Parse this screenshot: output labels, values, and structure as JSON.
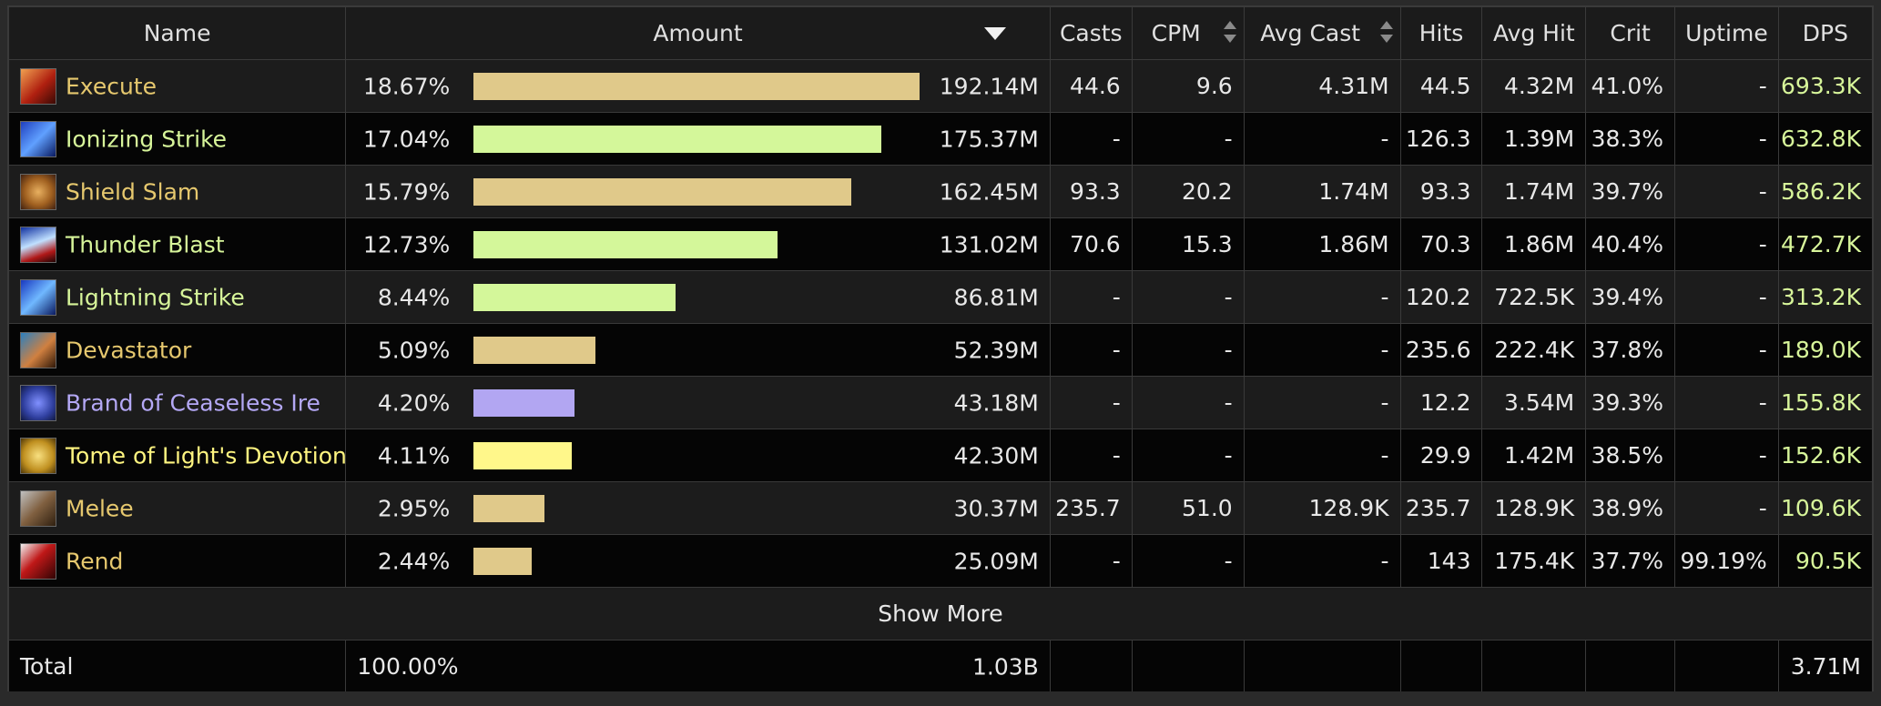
{
  "header": {
    "name": "Name",
    "amount": "Amount",
    "casts": "Casts",
    "cpm": "CPM",
    "avg_cast": "Avg Cast",
    "hits": "Hits",
    "avg_hit": "Avg Hit",
    "crit": "Crit",
    "uptime": "Uptime",
    "dps": "DPS"
  },
  "rows": [
    {
      "name": "Execute",
      "icon": "execute-icon",
      "color": "#e6c86e",
      "pct": "18.67%",
      "bar_fraction": 1.0,
      "bar_color": "#e0c98a",
      "amount": "192.14M",
      "casts": "44.6",
      "cpm": "9.6",
      "avg_cast": "4.31M",
      "hits": "44.5",
      "avg_hit": "4.32M",
      "crit": "41.0%",
      "uptime": "-",
      "dps": "693.3K"
    },
    {
      "name": "Ionizing Strike",
      "icon": "ionizing-strike-icon",
      "color": "#d7f59a",
      "pct": "17.04%",
      "bar_fraction": 0.913,
      "bar_color": "#d4f79a",
      "amount": "175.37M",
      "casts": "-",
      "cpm": "-",
      "avg_cast": "-",
      "hits": "126.3",
      "avg_hit": "1.39M",
      "crit": "38.3%",
      "uptime": "-",
      "dps": "632.8K"
    },
    {
      "name": "Shield Slam",
      "icon": "shield-slam-icon",
      "color": "#e6c86e",
      "pct": "15.79%",
      "bar_fraction": 0.846,
      "bar_color": "#e0c98a",
      "amount": "162.45M",
      "casts": "93.3",
      "cpm": "20.2",
      "avg_cast": "1.74M",
      "hits": "93.3",
      "avg_hit": "1.74M",
      "crit": "39.7%",
      "uptime": "-",
      "dps": "586.2K"
    },
    {
      "name": "Thunder Blast",
      "icon": "thunder-blast-icon",
      "color": "#d7f59a",
      "pct": "12.73%",
      "bar_fraction": 0.682,
      "bar_color": "#d4f79a",
      "amount": "131.02M",
      "casts": "70.6",
      "cpm": "15.3",
      "avg_cast": "1.86M",
      "hits": "70.3",
      "avg_hit": "1.86M",
      "crit": "40.4%",
      "uptime": "-",
      "dps": "472.7K"
    },
    {
      "name": "Lightning Strike",
      "icon": "lightning-strike-icon",
      "color": "#d7f59a",
      "pct": "8.44%",
      "bar_fraction": 0.452,
      "bar_color": "#d4f79a",
      "amount": "86.81M",
      "casts": "-",
      "cpm": "-",
      "avg_cast": "-",
      "hits": "120.2",
      "avg_hit": "722.5K",
      "crit": "39.4%",
      "uptime": "-",
      "dps": "313.2K"
    },
    {
      "name": "Devastator",
      "icon": "devastator-icon",
      "color": "#e6c86e",
      "pct": "5.09%",
      "bar_fraction": 0.273,
      "bar_color": "#e0c98a",
      "amount": "52.39M",
      "casts": "-",
      "cpm": "-",
      "avg_cast": "-",
      "hits": "235.6",
      "avg_hit": "222.4K",
      "crit": "37.8%",
      "uptime": "-",
      "dps": "189.0K"
    },
    {
      "name": "Brand of Ceaseless Ire",
      "icon": "brand-of-ceaseless-ire-icon",
      "color": "#b4a8f5",
      "pct": "4.20%",
      "bar_fraction": 0.225,
      "bar_color": "#b2a6f2",
      "amount": "43.18M",
      "casts": "-",
      "cpm": "-",
      "avg_cast": "-",
      "hits": "12.2",
      "avg_hit": "3.54M",
      "crit": "39.3%",
      "uptime": "-",
      "dps": "155.8K"
    },
    {
      "name": "Tome of Light's Devotion",
      "icon": "tome-of-lights-devotion-icon",
      "color": "#fff580",
      "pct": "4.11%",
      "bar_fraction": 0.22,
      "bar_color": "#fff78a",
      "amount": "42.30M",
      "casts": "-",
      "cpm": "-",
      "avg_cast": "-",
      "hits": "29.9",
      "avg_hit": "1.42M",
      "crit": "38.5%",
      "uptime": "-",
      "dps": "152.6K"
    },
    {
      "name": "Melee",
      "icon": "melee-icon",
      "color": "#e6c86e",
      "pct": "2.95%",
      "bar_fraction": 0.158,
      "bar_color": "#e0c98a",
      "amount": "30.37M",
      "casts": "235.7",
      "cpm": "51.0",
      "avg_cast": "128.9K",
      "hits": "235.7",
      "avg_hit": "128.9K",
      "crit": "38.9%",
      "uptime": "-",
      "dps": "109.6K"
    },
    {
      "name": "Rend",
      "icon": "rend-icon",
      "color": "#e6c86e",
      "pct": "2.44%",
      "bar_fraction": 0.131,
      "bar_color": "#e0c98a",
      "amount": "25.09M",
      "casts": "-",
      "cpm": "-",
      "avg_cast": "-",
      "hits": "143",
      "avg_hit": "175.4K",
      "crit": "37.7%",
      "uptime": "99.19%",
      "dps": "90.5K"
    }
  ],
  "show_more": "Show More",
  "total": {
    "label": "Total",
    "pct": "100.00%",
    "amount": "1.03B",
    "dps": "3.71M"
  }
}
